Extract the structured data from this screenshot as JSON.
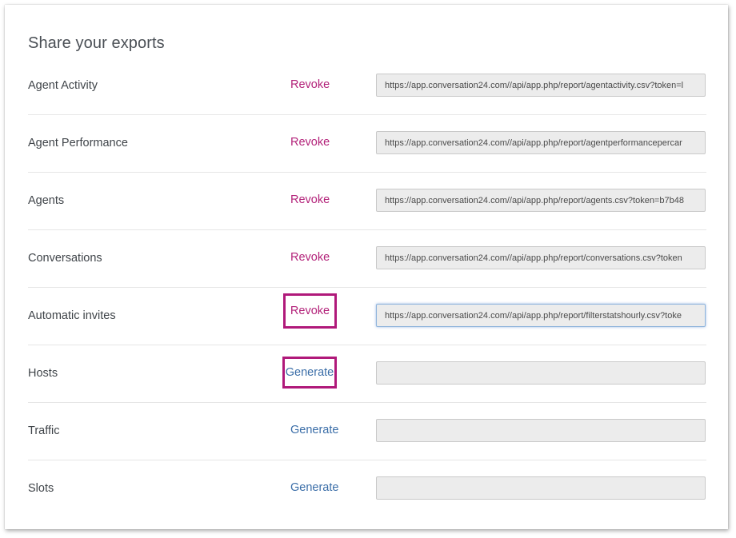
{
  "page": {
    "title": "Share your exports"
  },
  "colors": {
    "revoke": "#b3237a",
    "generate": "#3b6ea8",
    "highlight": "#b0197a"
  },
  "rows": [
    {
      "label": "Agent Activity",
      "action": "Revoke",
      "url": "https://app.conversation24.com//api/app.php/report/agentactivity.csv?token=l"
    },
    {
      "label": "Agent Performance",
      "action": "Revoke",
      "url": "https://app.conversation24.com//api/app.php/report/agentperformancepercar"
    },
    {
      "label": "Agents",
      "action": "Revoke",
      "url": "https://app.conversation24.com//api/app.php/report/agents.csv?token=b7b48"
    },
    {
      "label": "Conversations",
      "action": "Revoke",
      "url": "https://app.conversation24.com//api/app.php/report/conversations.csv?token"
    },
    {
      "label": "Automatic invites",
      "action": "Revoke",
      "url": "https://app.conversation24.com//api/app.php/report/filterstatshourly.csv?toke"
    },
    {
      "label": "Hosts",
      "action": "Generate",
      "url": ""
    },
    {
      "label": "Traffic",
      "action": "Generate",
      "url": ""
    },
    {
      "label": "Slots",
      "action": "Generate",
      "url": ""
    }
  ]
}
